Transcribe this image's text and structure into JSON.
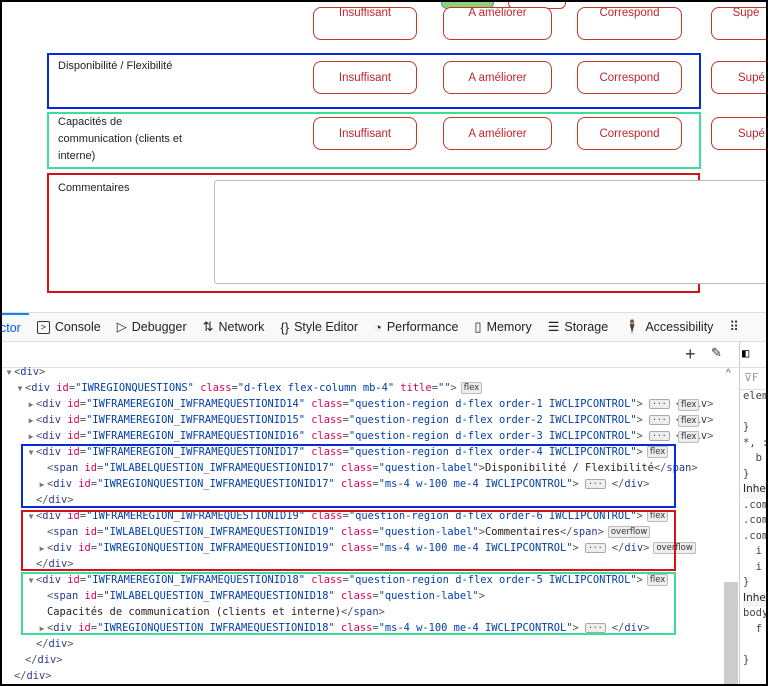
{
  "page": {
    "top_buttons_partial": [
      "Insuffisant",
      "A améliorer",
      "Correspond",
      "Supé"
    ],
    "questions": [
      {
        "label": "Disponibilité / Flexibilité",
        "options": [
          "Insuffisant",
          "A améliorer",
          "Correspond",
          "Supé"
        ]
      },
      {
        "label_lines": [
          "Capacités de",
          "communication (clients et",
          "interne)"
        ],
        "options": [
          "Insuffisant",
          "A améliorer",
          "Correspond",
          "Supé"
        ]
      }
    ],
    "comment_label": "Commentaires",
    "comment_value": ""
  },
  "devtools": {
    "tabs": [
      {
        "label": "ctor",
        "icon": ""
      },
      {
        "label": "Console",
        "icon": "console-icon"
      },
      {
        "label": "Debugger",
        "icon": "debugger-icon"
      },
      {
        "label": "Network",
        "icon": "network-icon"
      },
      {
        "label": "Style Editor",
        "icon": "style-editor-icon"
      },
      {
        "label": "Performance",
        "icon": "performance-icon"
      },
      {
        "label": "Memory",
        "icon": "memory-icon"
      },
      {
        "label": "Storage",
        "icon": "storage-icon"
      },
      {
        "label": "Accessibility",
        "icon": "accessibility-icon"
      }
    ],
    "side_lines": [
      "elem",
      "",
      "}",
      "*, :",
      "  b",
      "}",
      "Inhe",
      ".com",
      ".com",
      ".com",
      "  i",
      "  i",
      "}",
      "Inhe",
      "body",
      "  f",
      "",
      "}"
    ],
    "code_lines": [
      {
        "indent": 0,
        "toggle": "open",
        "tokens": [
          [
            "p",
            "<"
          ],
          [
            "t",
            "div"
          ],
          [
            "p",
            ">"
          ]
        ]
      },
      {
        "indent": 1,
        "toggle": "open",
        "tokens": [
          [
            "p",
            "<"
          ],
          [
            "t",
            "div "
          ],
          [
            "a",
            "id"
          ],
          [
            "p",
            "="
          ],
          [
            "v",
            "\"IWREGIONQUESTIONS\""
          ],
          [
            "a",
            " class"
          ],
          [
            "p",
            "="
          ],
          [
            "v",
            "\"d-flex flex-column mb-4\""
          ],
          [
            "a",
            " title"
          ],
          [
            "p",
            "="
          ],
          [
            "v",
            "\"\""
          ],
          [
            "p",
            ">"
          ]
        ],
        "badge": "flex"
      },
      {
        "indent": 2,
        "toggle": "closed",
        "tokens": [
          [
            "p",
            "<"
          ],
          [
            "t",
            "div "
          ],
          [
            "a",
            "id"
          ],
          [
            "p",
            "="
          ],
          [
            "v",
            "\"IWFRAMEREGION_IWFRAMEQUESTIONID14\""
          ],
          [
            "a",
            " class"
          ],
          [
            "p",
            "="
          ],
          [
            "v",
            "\"question-region d-flex order-1 IWCLIPCONTROL\""
          ],
          [
            "p",
            ">"
          ]
        ],
        "ellipsis": true,
        "close": "div",
        "badge": "flex"
      },
      {
        "indent": 2,
        "toggle": "closed",
        "tokens": [
          [
            "p",
            "<"
          ],
          [
            "t",
            "div "
          ],
          [
            "a",
            "id"
          ],
          [
            "p",
            "="
          ],
          [
            "v",
            "\"IWFRAMEREGION_IWFRAMEQUESTIONID15\""
          ],
          [
            "a",
            " class"
          ],
          [
            "p",
            "="
          ],
          [
            "v",
            "\"question-region d-flex order-2 IWCLIPCONTROL\""
          ],
          [
            "p",
            ">"
          ]
        ],
        "ellipsis": true,
        "close": "div",
        "badge": "flex"
      },
      {
        "indent": 2,
        "toggle": "closed",
        "tokens": [
          [
            "p",
            "<"
          ],
          [
            "t",
            "div "
          ],
          [
            "a",
            "id"
          ],
          [
            "p",
            "="
          ],
          [
            "v",
            "\"IWFRAMEREGION_IWFRAMEQUESTIONID16\""
          ],
          [
            "a",
            " class"
          ],
          [
            "p",
            "="
          ],
          [
            "v",
            "\"question-region d-flex order-3 IWCLIPCONTROL\""
          ],
          [
            "p",
            ">"
          ]
        ],
        "ellipsis": true,
        "close": "div",
        "badge": "flex"
      },
      {
        "indent": 2,
        "toggle": "open",
        "tokens": [
          [
            "p",
            "<"
          ],
          [
            "t",
            "div "
          ],
          [
            "a",
            "id"
          ],
          [
            "p",
            "="
          ],
          [
            "v",
            "\"IWFRAMEREGION_IWFRAMEQUESTIONID17\""
          ],
          [
            "a",
            " class"
          ],
          [
            "p",
            "="
          ],
          [
            "v",
            "\"question-region d-flex order-4 IWCLIPCONTROL\""
          ],
          [
            "p",
            ">"
          ]
        ],
        "badge": "flex"
      },
      {
        "indent": 3,
        "toggle": "",
        "tokens": [
          [
            "p",
            "<"
          ],
          [
            "t",
            "span "
          ],
          [
            "a",
            "id"
          ],
          [
            "p",
            "="
          ],
          [
            "v",
            "\"IWLABELQUESTION_IWFRAMEQUESTIONID17\""
          ],
          [
            "a",
            " class"
          ],
          [
            "p",
            "="
          ],
          [
            "v",
            "\"question-label\""
          ],
          [
            "p",
            ">"
          ],
          [
            "x",
            "Disponibilité / Flexibilité"
          ],
          [
            "p",
            "</"
          ],
          [
            "t",
            "span"
          ],
          [
            "p",
            ">"
          ]
        ]
      },
      {
        "indent": 3,
        "toggle": "closed",
        "tokens": [
          [
            "p",
            "<"
          ],
          [
            "t",
            "div "
          ],
          [
            "a",
            "id"
          ],
          [
            "p",
            "="
          ],
          [
            "v",
            "\"IWREGIONQUESTION_IWFRAMEQUESTIONID17\""
          ],
          [
            "a",
            " class"
          ],
          [
            "p",
            "="
          ],
          [
            "v",
            "\"ms-4 w-100 me-4 IWCLIPCONTROL\""
          ],
          [
            "p",
            ">"
          ]
        ],
        "ellipsis": true,
        "close": "div"
      },
      {
        "indent": 2,
        "toggle": "",
        "tokens": [
          [
            "p",
            "</"
          ],
          [
            "t",
            "div"
          ],
          [
            "p",
            ">"
          ]
        ]
      },
      {
        "indent": 2,
        "toggle": "open",
        "tokens": [
          [
            "p",
            "<"
          ],
          [
            "t",
            "div "
          ],
          [
            "a",
            "id"
          ],
          [
            "p",
            "="
          ],
          [
            "v",
            "\"IWFRAMEREGION_IWFRAMEQUESTIONID19\""
          ],
          [
            "a",
            " class"
          ],
          [
            "p",
            "="
          ],
          [
            "v",
            "\"question-region d-flex order-6 IWCLIPCONTROL\""
          ],
          [
            "p",
            ">"
          ]
        ],
        "badge": "flex"
      },
      {
        "indent": 3,
        "toggle": "",
        "tokens": [
          [
            "p",
            "<"
          ],
          [
            "t",
            "span "
          ],
          [
            "a",
            "id"
          ],
          [
            "p",
            "="
          ],
          [
            "v",
            "\"IWLABELQUESTION_IWFRAMEQUESTIONID19\""
          ],
          [
            "a",
            " class"
          ],
          [
            "p",
            "="
          ],
          [
            "v",
            "\"question-label\""
          ],
          [
            "p",
            ">"
          ],
          [
            "x",
            "Commentaires"
          ],
          [
            "p",
            "</"
          ],
          [
            "t",
            "span"
          ],
          [
            "p",
            ">"
          ]
        ],
        "badge": "overflow"
      },
      {
        "indent": 3,
        "toggle": "closed",
        "tokens": [
          [
            "p",
            "<"
          ],
          [
            "t",
            "div "
          ],
          [
            "a",
            "id"
          ],
          [
            "p",
            "="
          ],
          [
            "v",
            "\"IWREGIONQUESTION_IWFRAMEQUESTIONID19\""
          ],
          [
            "a",
            " class"
          ],
          [
            "p",
            "="
          ],
          [
            "v",
            "\"ms-4 w-100 me-4 IWCLIPCONTROL\""
          ],
          [
            "p",
            ">"
          ]
        ],
        "ellipsis": true,
        "close": "div",
        "badge": "overflow"
      },
      {
        "indent": 2,
        "toggle": "",
        "tokens": [
          [
            "p",
            "</"
          ],
          [
            "t",
            "div"
          ],
          [
            "p",
            ">"
          ]
        ]
      },
      {
        "indent": 2,
        "toggle": "open",
        "tokens": [
          [
            "p",
            "<"
          ],
          [
            "t",
            "div "
          ],
          [
            "a",
            "id"
          ],
          [
            "p",
            "="
          ],
          [
            "v",
            "\"IWFRAMEREGION_IWFRAMEQUESTIONID18\""
          ],
          [
            "a",
            " class"
          ],
          [
            "p",
            "="
          ],
          [
            "v",
            "\"question-region d-flex order-5 IWCLIPCONTROL\""
          ],
          [
            "p",
            ">"
          ]
        ],
        "badge": "flex"
      },
      {
        "indent": 3,
        "toggle": "",
        "tokens": [
          [
            "p",
            "<"
          ],
          [
            "t",
            "span "
          ],
          [
            "a",
            "id"
          ],
          [
            "p",
            "="
          ],
          [
            "v",
            "\"IWLABELQUESTION_IWFRAMEQUESTIONID18\""
          ],
          [
            "a",
            " class"
          ],
          [
            "p",
            "="
          ],
          [
            "v",
            "\"question-label\""
          ],
          [
            "p",
            ">"
          ]
        ]
      },
      {
        "indent": 3,
        "toggle": "",
        "tokens": [
          [
            "x",
            "Capacités de communication (clients et interne)"
          ],
          [
            "p",
            "</"
          ],
          [
            "t",
            "span"
          ],
          [
            "p",
            ">"
          ]
        ]
      },
      {
        "indent": 3,
        "toggle": "closed",
        "tokens": [
          [
            "p",
            "<"
          ],
          [
            "t",
            "div "
          ],
          [
            "a",
            "id"
          ],
          [
            "p",
            "="
          ],
          [
            "v",
            "\"IWREGIONQUESTION_IWFRAMEQUESTIONID18\""
          ],
          [
            "a",
            " class"
          ],
          [
            "p",
            "="
          ],
          [
            "v",
            "\"ms-4 w-100 me-4 IWCLIPCONTROL\""
          ],
          [
            "p",
            ">"
          ]
        ],
        "ellipsis": true,
        "close": "div"
      },
      {
        "indent": 2,
        "toggle": "",
        "tokens": [
          [
            "p",
            "</"
          ],
          [
            "t",
            "div"
          ],
          [
            "p",
            ">"
          ]
        ]
      },
      {
        "indent": 1,
        "toggle": "",
        "tokens": [
          [
            "p",
            "</"
          ],
          [
            "t",
            "div"
          ],
          [
            "p",
            ">"
          ]
        ]
      },
      {
        "indent": 0,
        "toggle": "",
        "tokens": [
          [
            "p",
            "</"
          ],
          [
            "t",
            "div"
          ],
          [
            "p",
            ">"
          ]
        ]
      }
    ],
    "highlight_colors": {
      "blue": "#0a2ad6",
      "red": "#d4121a",
      "green": "#3ddc97"
    }
  }
}
